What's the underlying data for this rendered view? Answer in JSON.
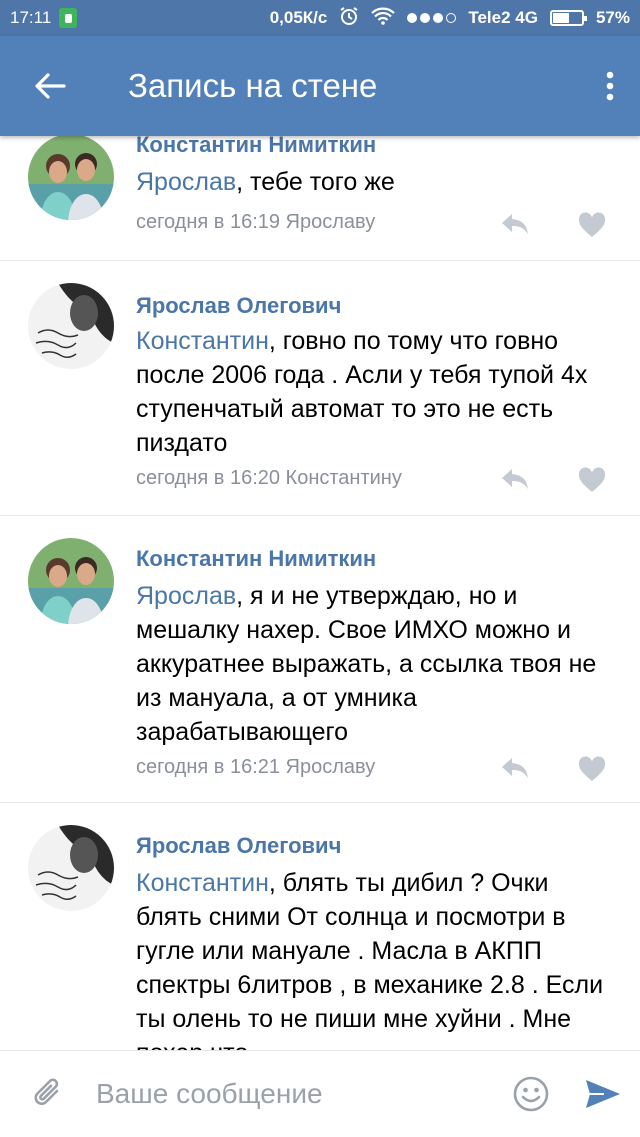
{
  "status_bar": {
    "time": "17:11",
    "speed": "0,05К/с",
    "carrier": "Tele2 4G",
    "battery": "57%",
    "battery_level": 0.57
  },
  "app_bar": {
    "title": "Запись на стене"
  },
  "comments": [
    {
      "author": "Константин Нимиткин",
      "mention": "Ярослав",
      "text": ", тебе того же",
      "meta": "сегодня в 16:19 Ярославу"
    },
    {
      "author": "Ярослав Олегович",
      "mention": "Константин",
      "text": ", говно по тому что говно после 2006 года . Асли у тебя тупой 4х ступенчатый автомат то это не есть пиздато",
      "meta": "сегодня в 16:20 Константину"
    },
    {
      "author": "Константин Нимиткин",
      "mention": "Ярослав",
      "text": ", я и не утверждаю, но и мешалку нахер. Свое ИМХО можно и аккуратнее выражать, а ссылка твоя не из мануала, а от умника зарабатывающего",
      "meta": "сегодня в 16:21 Ярославу"
    },
    {
      "author": "Ярослав Олегович",
      "mention": "Константин",
      "text": ", блять ты дибил ? Очки блять сними От солнца и посмотри в гугле или мануале . Масла в АКПП спектры 6литров , в механике 2.8 . Если ты олень то не пиши мне хуйни . Мне похер что",
      "meta": ""
    }
  ],
  "composer": {
    "placeholder": "Ваше сообщение"
  },
  "colors": {
    "status_bar": "#4f76a8",
    "app_bar": "#5181b8",
    "link": "#4a76a8",
    "meta": "#8a9099",
    "icon": "#c4cad1",
    "send": "#5181b8"
  }
}
